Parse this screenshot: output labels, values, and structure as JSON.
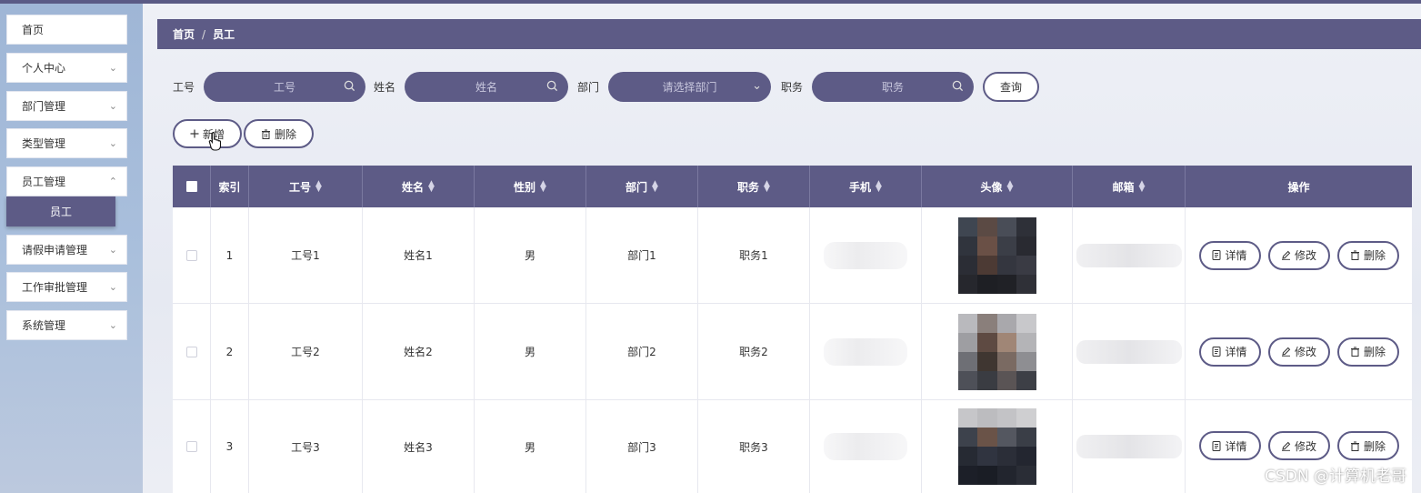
{
  "sidebar": {
    "items": [
      {
        "label": "首页",
        "has_children": false
      },
      {
        "label": "个人中心",
        "has_children": true
      },
      {
        "label": "部门管理",
        "has_children": true
      },
      {
        "label": "类型管理",
        "has_children": true
      },
      {
        "label": "员工管理",
        "has_children": true
      },
      {
        "label": "请假申请管理",
        "has_children": true
      },
      {
        "label": "工作审批管理",
        "has_children": true
      },
      {
        "label": "系统管理",
        "has_children": true
      }
    ],
    "active_submenu": "员工"
  },
  "breadcrumb": {
    "home": "首页",
    "separator": "/",
    "current": "员工"
  },
  "search": {
    "job_no": {
      "label": "工号",
      "placeholder": "工号"
    },
    "name": {
      "label": "姓名",
      "placeholder": "姓名"
    },
    "department": {
      "label": "部门",
      "placeholder": "请选择部门"
    },
    "position": {
      "label": "职务",
      "placeholder": "职务"
    },
    "query_label": "查询"
  },
  "actions": {
    "add_label": "新增",
    "delete_label": "删除"
  },
  "table": {
    "columns": {
      "index": "索引",
      "job_no": "工号",
      "name": "姓名",
      "gender": "性别",
      "department": "部门",
      "position": "职务",
      "phone": "手机",
      "avatar": "头像",
      "email": "邮箱",
      "ops": "操作"
    },
    "rows": [
      {
        "index": "1",
        "job_no": "工号1",
        "name": "姓名1",
        "gender": "男",
        "department": "部门1",
        "position": "职务1"
      },
      {
        "index": "2",
        "job_no": "工号2",
        "name": "姓名2",
        "gender": "男",
        "department": "部门2",
        "position": "职务2"
      },
      {
        "index": "3",
        "job_no": "工号3",
        "name": "姓名3",
        "gender": "男",
        "department": "部门3",
        "position": "职务3"
      }
    ],
    "ops": {
      "detail": "详情",
      "edit": "修改",
      "delete": "删除"
    }
  },
  "watermark": "CSDN @计算机老哥",
  "colors": {
    "primary": "#5d5b86",
    "sidebar": "#a9bfdc",
    "border": "#e7e8ef"
  }
}
